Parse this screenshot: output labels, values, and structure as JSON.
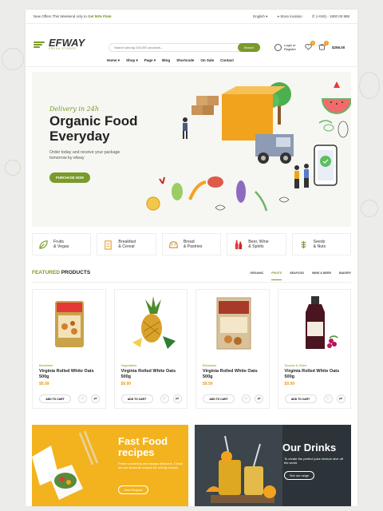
{
  "topbar": {
    "promo_prefix": "New Offers This Weekend only to",
    "promo_highlight": "Get 50% Flate",
    "language": "English",
    "store_location": "Store location",
    "phone": "(+040) - 1800 00 888"
  },
  "brand": {
    "name": "EFWAY",
    "tagline": "FRESH STORES"
  },
  "search": {
    "placeholder": "Search among 100,000 products...",
    "button": "Search"
  },
  "account": {
    "line1": "Login or",
    "line2": "Register"
  },
  "wishlist_count": "0",
  "cart": {
    "count": "2",
    "total": "$256.00"
  },
  "nav": [
    "Home",
    "Shop",
    "Page",
    "Blog",
    "Shortcode",
    "On Sale",
    "Contact"
  ],
  "hero": {
    "tagline": "Delivery in 24h",
    "title": "Organic Food Everyday",
    "subtitle": "Order today and receive your package tomorrow by efway",
    "button": "PURCHASE NOW"
  },
  "categories": [
    {
      "line1": "Fruits",
      "line2": "& Vegas",
      "icon": "leaf-icon"
    },
    {
      "line1": "Breakfast",
      "line2": "& Cereal",
      "icon": "cereal-box-icon"
    },
    {
      "line1": "Bread",
      "line2": "& Pastries",
      "icon": "bread-icon"
    },
    {
      "line1": "Beer, Wine",
      "line2": "& Spirits",
      "icon": "bottles-icon"
    },
    {
      "line1": "Seeds",
      "line2": "& Nuts",
      "icon": "seeds-icon"
    }
  ],
  "featured": {
    "title_highlight": "FEATURED",
    "title_rest": "PRODUCTS",
    "tabs": [
      "ORGANIC",
      "FRUITS",
      "SEAFOOD",
      "WINE & BEER",
      "BAKERY"
    ],
    "active_tab": "FRUITS"
  },
  "products": [
    {
      "category": "Breakfast",
      "name": "Virginia Rolled White Oats 500g",
      "price": "$9.99",
      "add": "ADD TO CART",
      "image": "granola-bag"
    },
    {
      "category": "Vegetables",
      "name": "Virginia Rolled White Oats 500g",
      "price": "$9.99",
      "add": "ADD TO CART",
      "image": "pineapple"
    },
    {
      "category": "Breakfast",
      "name": "Virginia Rolled White Oats 500g",
      "price": "$9.99",
      "add": "ADD TO CART",
      "image": "cereal-box"
    },
    {
      "category": "Snacks & Sides",
      "name": "Virginia Rolled White Oats 500g",
      "price": "$9.99",
      "add": "ADD TO CART",
      "image": "juice-bottle"
    }
  ],
  "banners": [
    {
      "title": "Fast Food recipes",
      "text": "Fresh nourishing one always delicious. Check out our favourite recipes for a fruity revival.",
      "button": "View Recipes"
    },
    {
      "title": "Our Drinks",
      "text": "To create the perfect juice mixture dive off the world",
      "button": "See our range"
    }
  ],
  "colors": {
    "accent": "#7a9a2a",
    "orange": "#f29a1f",
    "banner_yellow": "#f3b31e",
    "banner_dark": "#2c3439"
  }
}
